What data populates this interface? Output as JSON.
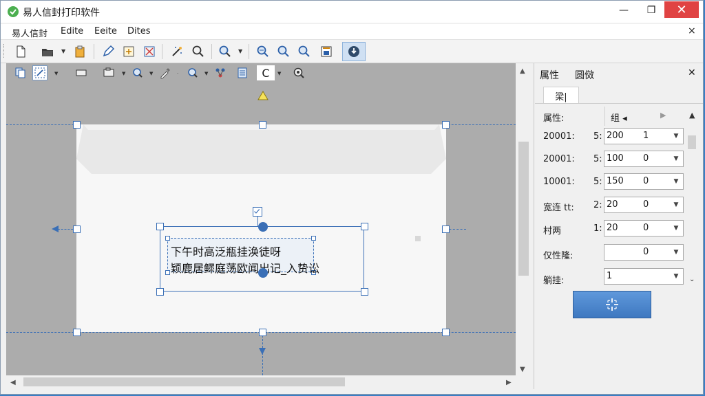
{
  "window": {
    "title": "易人信封打印软件",
    "min_glyph": "—",
    "max_glyph": "❐",
    "close_glyph": "✕"
  },
  "menu": {
    "items": [
      "易人信封",
      "Edite",
      "Eeite",
      "Dites"
    ],
    "close_glyph": "×"
  },
  "toolbar": {
    "icons": [
      "new-file-icon",
      "open-folder-icon",
      "paste-icon",
      "pen-icon",
      "edit-frame-icon",
      "tools-icon",
      "magic-wand-icon",
      "search-icon",
      "zoom-drop-icon",
      "zoom-out-icon",
      "zoom-in-icon",
      "zoom-fit-icon",
      "frame-icon",
      "download-icon"
    ]
  },
  "toolbar2": {
    "c_label": "C"
  },
  "envelope": {
    "address_lines": [
      "下午时高泛瓶挂涣徒呀",
      "颖鹿居鳏庭荡欧闻出记_入贽讼"
    ]
  },
  "panel": {
    "tabs": [
      "属性",
      "圆傚"
    ],
    "close_glyph": "✕",
    "subtab": "梁|",
    "header_label": "属性:",
    "header_group": "组 ◂",
    "header_next": "▶",
    "header_up": "▲",
    "rows": [
      {
        "label": "20001:",
        "num": "5:",
        "a": "200",
        "b": "1"
      },
      {
        "label": "20001:",
        "num": "5:",
        "a": "100",
        "b": "0"
      },
      {
        "label": "10001:",
        "num": "5:",
        "a": "150",
        "b": "0"
      },
      {
        "label": "宽连 tt:",
        "num": "2:",
        "a": "20",
        "b": "0"
      },
      {
        "label": "村两",
        "num": "1:",
        "a": "20",
        "b": "0"
      },
      {
        "label": "仅性隆:",
        "num": "",
        "a": "",
        "b": "0"
      },
      {
        "label": "躺挂:",
        "num": "",
        "a": "1",
        "b": ""
      }
    ],
    "button_icon": "crosshair-icon"
  },
  "colors": {
    "accent": "#3a6fb6",
    "close_red": "#e04343",
    "canvas": "#acacac",
    "envelope": "#f7f7f7"
  }
}
